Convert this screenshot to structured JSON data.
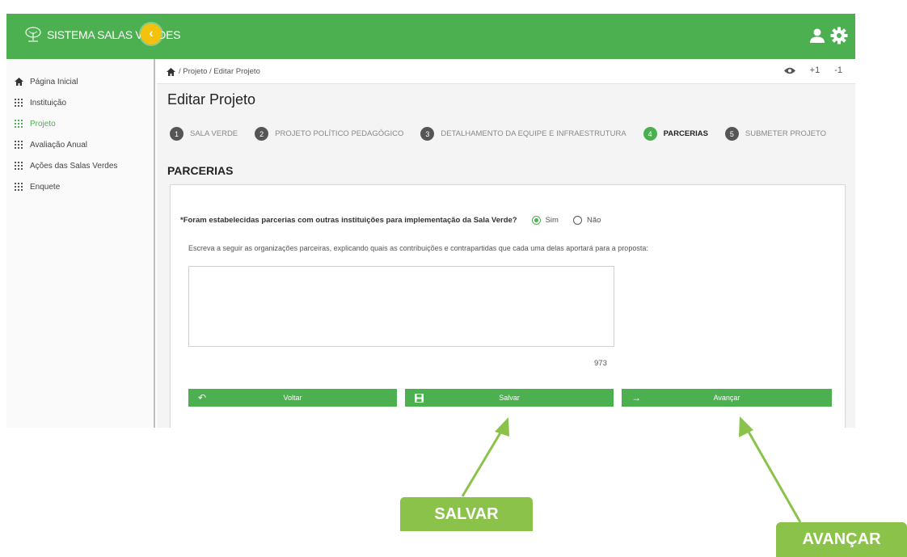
{
  "app": {
    "title": "SISTEMA SALAS VERDES"
  },
  "colors": {
    "primary": "#4caf50",
    "accent_toggle": "#f4c20d",
    "callout": "#8bc34a"
  },
  "icons": {
    "collapse": "chevron-left-icon",
    "user": "user-icon",
    "settings": "gear-icon",
    "home": "home-icon",
    "view": "eye-icon"
  },
  "sidebar": {
    "items": [
      {
        "label": "Página Inicial",
        "icon": "home-icon",
        "active": false
      },
      {
        "label": "Instituição",
        "icon": "grid-icon",
        "active": false
      },
      {
        "label": "Projeto",
        "icon": "grid-icon",
        "active": true
      },
      {
        "label": "Avaliação Anual",
        "icon": "grid-icon",
        "active": false
      },
      {
        "label": "Ações das Salas Verdes",
        "icon": "grid-icon",
        "active": false
      },
      {
        "label": "Enquete",
        "icon": "grid-icon",
        "active": false
      }
    ]
  },
  "breadcrumb": {
    "text": "/ Projeto / Editar Projeto"
  },
  "zoom": {
    "increase": "+1",
    "decrease": "-1"
  },
  "page": {
    "title": "Editar Projeto",
    "section": "PARCERIAS"
  },
  "steps": [
    {
      "num": "1",
      "label": "SALA VERDE"
    },
    {
      "num": "2",
      "label": "PROJETO POLÍTICO PEDAGÓGICO"
    },
    {
      "num": "3",
      "label": "DETALHAMENTO DA EQUIPE E INFRAESTRUTURA"
    },
    {
      "num": "4",
      "label": "PARCERIAS",
      "active": true
    },
    {
      "num": "5",
      "label": "SUBMETER PROJETO"
    }
  ],
  "form": {
    "question": "*Foram estabelecidas parcerias com outras instituições para implementação da Sala Verde?",
    "option_yes": "Sim",
    "option_no": "Não",
    "selected": "Sim",
    "instructions": "Escreva a seguir as organizações parceiras, explicando quais as contribuições e contrapartidas que cada uma delas aportará para a proposta:",
    "textarea_value": "",
    "char_counter": "973"
  },
  "buttons": {
    "back": "Voltar",
    "save": "Salvar",
    "next": "Avançar"
  },
  "callouts": {
    "save": "SALVAR",
    "next": "AVANÇAR"
  }
}
